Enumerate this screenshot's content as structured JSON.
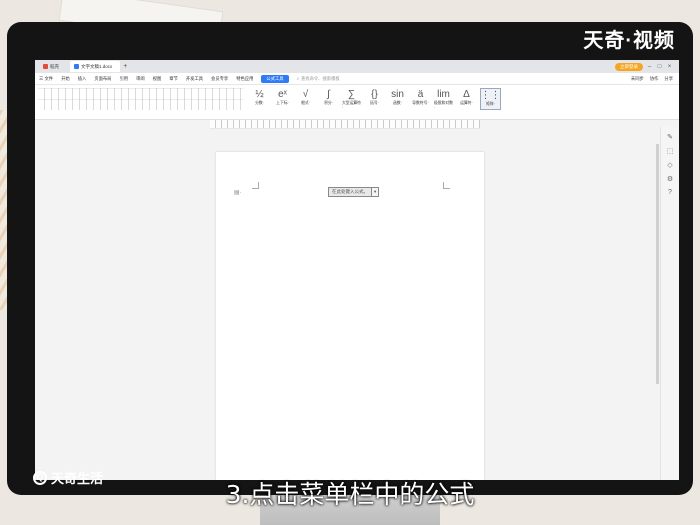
{
  "watermark": {
    "top_right": "天奇·视频",
    "bottom_left": "天奇生活",
    "bottom_left_logo": "Q"
  },
  "subtitle": "3.点击菜单栏中的公式",
  "app": {
    "tabs": [
      {
        "label": "稻壳",
        "icon": "wps-home-icon"
      },
      {
        "label": "文字文稿1.docx",
        "icon": "doc-icon"
      }
    ],
    "new_tab": "+",
    "login_label": "立即登录"
  },
  "menu": {
    "file": "三 文件",
    "items": [
      "开始",
      "插入",
      "页面布局",
      "引用",
      "审阅",
      "视图",
      "章节",
      "开发工具",
      "会员专享",
      "特色应用"
    ],
    "active": "公式工具",
    "search": "查找命令、搜索模板",
    "right": [
      "未同步",
      "协作",
      "分享"
    ]
  },
  "ribbon": {
    "tools": [
      {
        "label": "分数·",
        "icon": "fraction-icon"
      },
      {
        "label": "上下标·",
        "icon": "script-icon"
      },
      {
        "label": "根式·",
        "icon": "radical-icon"
      },
      {
        "label": "积分·",
        "icon": "integral-icon"
      },
      {
        "label": "大型运算符·",
        "icon": "large-operator-icon"
      },
      {
        "label": "括号·",
        "icon": "bracket-icon"
      },
      {
        "label": "函数·",
        "icon": "function-icon"
      },
      {
        "label": "导数符号·",
        "icon": "accent-icon"
      },
      {
        "label": "极限和对数·",
        "icon": "limit-icon"
      },
      {
        "label": "运算符·",
        "icon": "operator-icon"
      },
      {
        "label": "矩阵·",
        "icon": "matrix-icon"
      }
    ]
  },
  "document": {
    "formula_placeholder": "在此处键入公式。"
  }
}
